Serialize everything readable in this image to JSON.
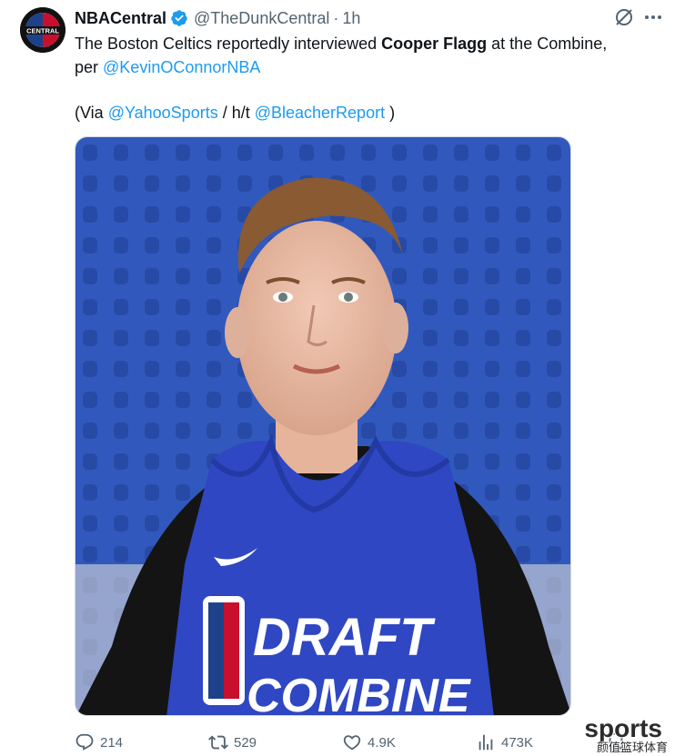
{
  "tweet": {
    "author_name": "NBACentral",
    "handle": "@TheDunkCentral",
    "separator": "·",
    "time": "1h",
    "text_part1": "The Boston Celtics reportedly interviewed ",
    "text_bold": "Cooper Flagg",
    "text_part2": " at the Combine,",
    "text_per": "per ",
    "mention_kevin": "@KevinOConnorNBA",
    "via_open": "(Via ",
    "mention_yahoo": "@YahooSports",
    "via_ht": " / h/t ",
    "mention_bleacher": "@BleacherReport",
    "via_close": " )"
  },
  "avatar": {
    "logo_text": "CENTRAL"
  },
  "media": {
    "jersey_line1": "DRAFT",
    "jersey_line2": "COMBINE"
  },
  "actions": {
    "replies": "214",
    "reposts": "529",
    "likes": "4.9K",
    "views": "473K"
  },
  "watermark": {
    "main": "sports",
    "sub": "颜值篮球体育"
  },
  "colors": {
    "link": "#1d9bf0",
    "secondary": "#536471",
    "verified": "#1d9bf0",
    "jersey": "#2f47c2",
    "court_bg": "#2f55b7"
  },
  "icons": [
    "verified-badge-icon",
    "grok-icon",
    "more-icon",
    "reply-icon",
    "repost-icon",
    "like-icon",
    "views-icon",
    "bookmark-icon"
  ]
}
